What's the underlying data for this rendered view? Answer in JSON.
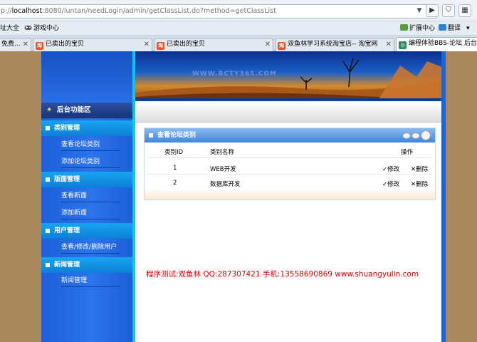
{
  "browser": {
    "url_prefix": "p://",
    "url_host": "localhost",
    "url_path": ":8080/luntan/needLogin/admin/getClassList.do?method=getClassList",
    "favorites": [
      {
        "label": "址大全",
        "icon": "grid-icon"
      },
      {
        "label": "游戏中心",
        "icon": "gamepad-icon"
      }
    ],
    "extension_center": "扩展中心",
    "translate": "翻译",
    "tabs": [
      {
        "label": "免费...",
        "icon": "taobao-icon"
      },
      {
        "label": "已卖出的宝贝",
        "icon": "taobao-icon"
      },
      {
        "label": "已卖出的宝贝",
        "icon": "taobao-icon"
      },
      {
        "label": "双鱼林学习系统淘宝店-- 淘宝网",
        "icon": "taobao-icon"
      },
      {
        "label": "编程体验BBS-论坛 后台",
        "icon": "page-icon"
      }
    ]
  },
  "banner": {
    "site": "WWW.BCTY365.COM"
  },
  "sidebar": {
    "title": "后台功能区",
    "sections": [
      {
        "label": "类别管理",
        "items": [
          "查看论坛类别",
          "添加论坛类别"
        ]
      },
      {
        "label": "版面管理",
        "items": [
          "查看新面",
          "添加新面"
        ]
      },
      {
        "label": "用户管理",
        "items": [
          "查看/修改/删除用户"
        ]
      },
      {
        "label": "新闻管理",
        "items": [
          "新闻管理"
        ]
      }
    ]
  },
  "panel": {
    "title": "查看论坛类别",
    "columns": [
      "类别ID",
      "类别名称",
      "操作"
    ],
    "rows": [
      {
        "id": "1",
        "name": "WEB开发",
        "edit": "修改",
        "delete": "删除"
      },
      {
        "id": "2",
        "name": "数据库开发",
        "edit": "修改",
        "delete": "删除"
      }
    ]
  },
  "footer_info": "程序测试:双鱼林 QQ:287307421 手机:13558690869 www.shuangyulin.com",
  "colors": {
    "sidebar": "#2b74ec",
    "category": "#0b80d8",
    "info_text": "#e00000"
  }
}
